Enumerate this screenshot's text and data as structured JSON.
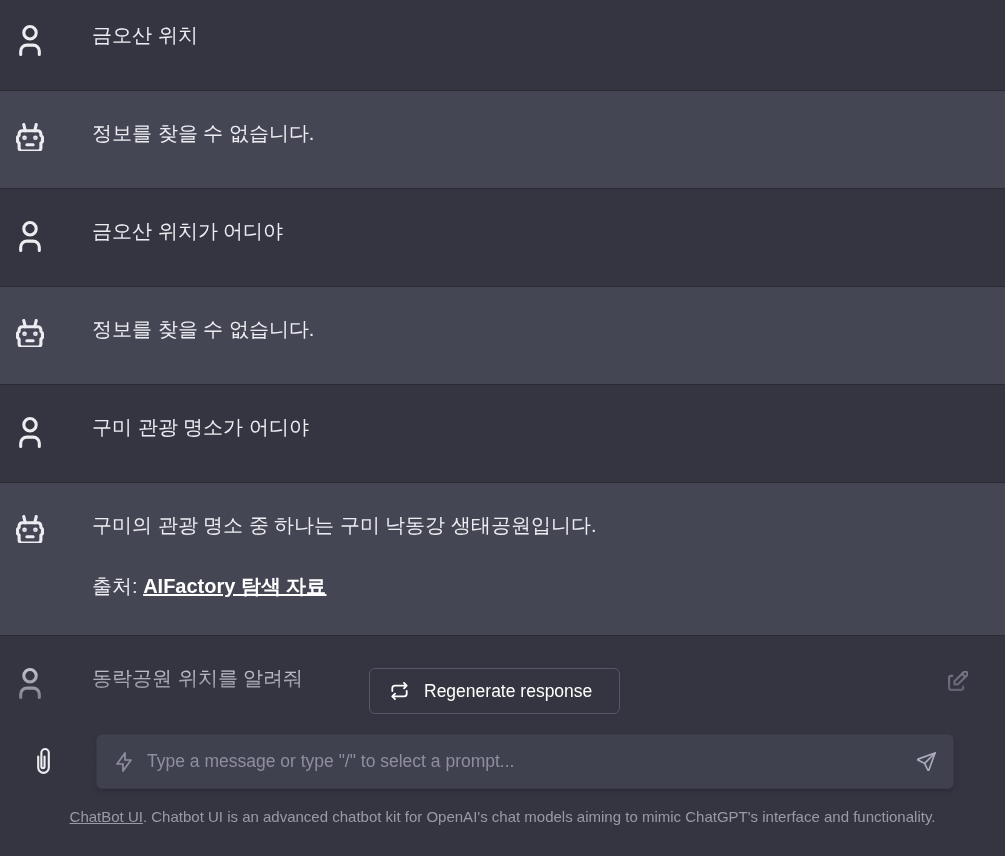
{
  "messages": [
    {
      "kind": "user",
      "hovered": false,
      "paragraphs": [
        {
          "text": "금오산 위치"
        }
      ]
    },
    {
      "kind": "bot",
      "hovered": false,
      "paragraphs": [
        {
          "text": "정보를 찾을 수 없습니다."
        }
      ]
    },
    {
      "kind": "user",
      "hovered": false,
      "paragraphs": [
        {
          "text": "금오산 위치가 어디야"
        }
      ]
    },
    {
      "kind": "bot",
      "hovered": false,
      "paragraphs": [
        {
          "text": "정보를 찾을 수 없습니다."
        }
      ]
    },
    {
      "kind": "user",
      "hovered": false,
      "paragraphs": [
        {
          "text": "구미 관광 명소가 어디야"
        }
      ]
    },
    {
      "kind": "bot",
      "hovered": false,
      "paragraphs": [
        {
          "text": "구미의 관광 명소 중 하나는 구미 낙동강 생태공원입니다."
        },
        {
          "text": "출처: ",
          "link": "AIFactory 탐색 자료"
        }
      ]
    },
    {
      "kind": "user",
      "hovered": true,
      "paragraphs": [
        {
          "text": "동락공원 위치를 알려줘"
        }
      ]
    }
  ],
  "regenerate_button": {
    "label": "Regenerate response"
  },
  "message_input": {
    "placeholder": "Type a message or type \"/\" to select a prompt..."
  },
  "footer": {
    "link": "ChatBot UI",
    "text": ". Chatbot UI is an advanced chatbot kit for OpenAI's chat models aiming to mimic ChatGPT's interface and functionality."
  }
}
